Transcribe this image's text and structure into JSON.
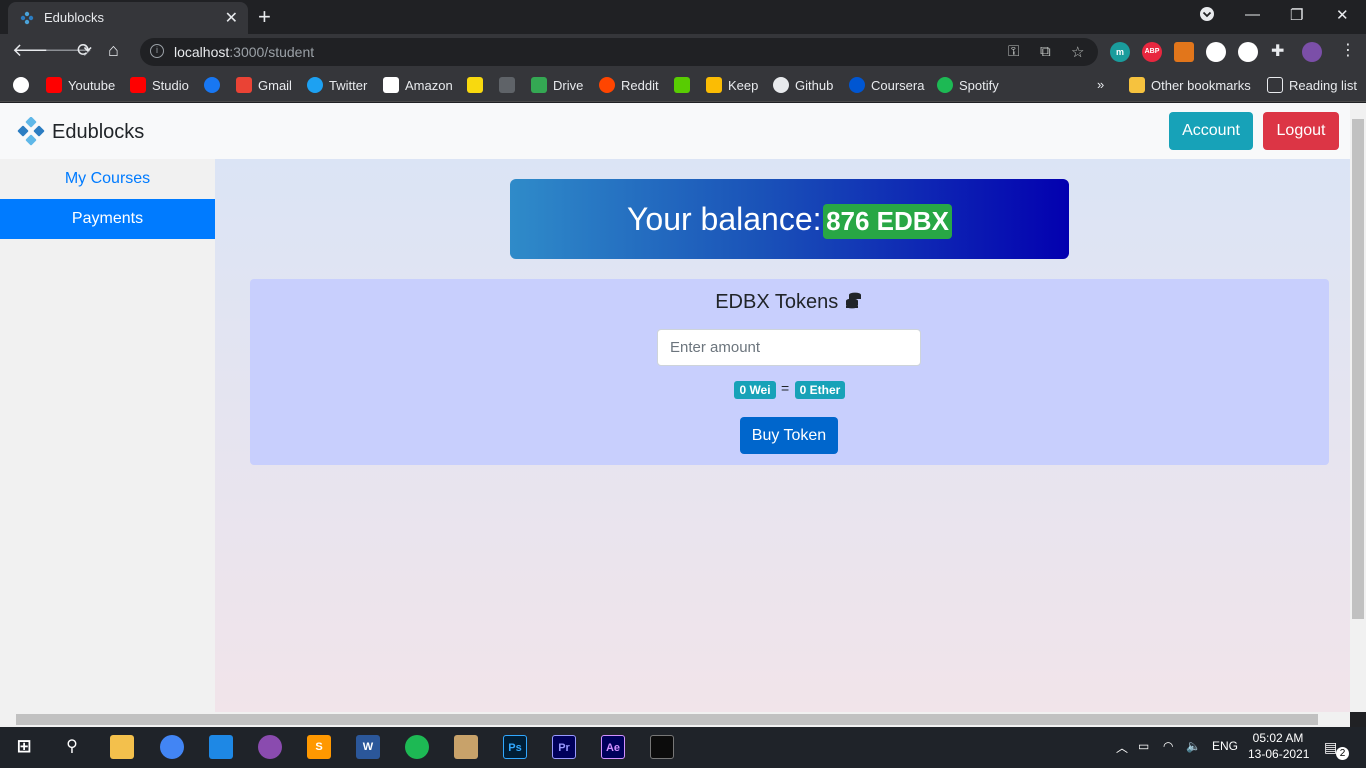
{
  "browser": {
    "tab_title": "Edublocks",
    "url_host": "localhost",
    "url_rest": ":3000/student",
    "bookmarks": [
      "Youtube",
      "Studio",
      "Gmail",
      "Twitter",
      "Amazon",
      "Drive",
      "Reddit",
      "Keep",
      "Github",
      "Coursera",
      "Spotify"
    ],
    "other_bookmarks": "Other bookmarks",
    "reading_list": "Reading list",
    "extensions": [
      "m",
      "ABP"
    ]
  },
  "navbar": {
    "brand": "Edublocks",
    "account_label": "Account",
    "logout_label": "Logout"
  },
  "sidebar": {
    "items": [
      {
        "label": "My Courses",
        "active": false
      },
      {
        "label": "Payments",
        "active": true
      }
    ]
  },
  "balance": {
    "label": "Your balance:",
    "amount": "876 EDBX"
  },
  "tokens": {
    "heading": "EDBX Tokens",
    "amount_placeholder": "Enter amount",
    "wei_badge": "0 Wei",
    "equals": "=",
    "ether_badge": "0 Ether",
    "buy_label": "Buy Token"
  },
  "taskbar": {
    "language": "ENG",
    "time": "05:02 AM",
    "date": "13-06-2021",
    "notifications": "2"
  },
  "colors": {
    "account": "#17a2b8",
    "logout": "#dc3545",
    "active_nav": "#007bff",
    "link": "#007bff",
    "balance_badge": "#28a745",
    "token_panel": "#c8cffd"
  }
}
